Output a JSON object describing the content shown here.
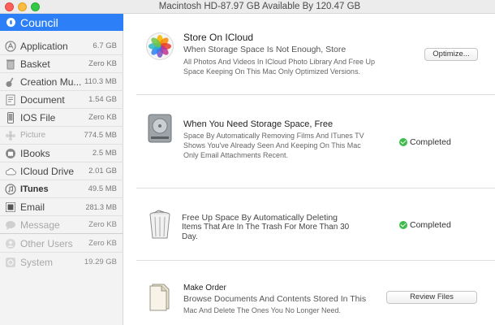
{
  "window": {
    "title": "Macintosh HD-87.97 GB Available By 120.47 GB"
  },
  "sidebar": {
    "selected": {
      "label": "Council"
    },
    "items": [
      {
        "label": "Application",
        "size": "6.7 GB",
        "icon": "application-icon"
      },
      {
        "label": "Basket",
        "size": "Zero KB",
        "icon": "trash-icon"
      },
      {
        "label": "Creation Mu...",
        "size": "110.3 MB",
        "icon": "guitar-icon"
      },
      {
        "label": "Document",
        "size": "1.54 GB",
        "icon": "document-icon"
      },
      {
        "label": "IOS File",
        "size": "Zero KB",
        "icon": "phone-icon"
      },
      {
        "label": "Picture",
        "size": "774.5 MB",
        "icon": "flower-icon"
      },
      {
        "label": "IBooks",
        "size": "2.5 MB",
        "icon": "book-icon"
      },
      {
        "label": "ICloud Drive",
        "size": "2.01 GB",
        "icon": "cloud-icon"
      },
      {
        "label": "ITunes",
        "size": "49.5 MB",
        "icon": "music-icon"
      },
      {
        "label": "Email",
        "size": "281.3 MB",
        "icon": "stamp-icon"
      },
      {
        "label": "Message",
        "size": "Zero KB",
        "icon": "message-icon"
      },
      {
        "label": "Other Users",
        "size": "Zero KB",
        "icon": "users-icon"
      },
      {
        "label": "System",
        "size": "19.29 GB",
        "icon": "gear-icon"
      }
    ]
  },
  "sections": {
    "icloud": {
      "title": "Store On ICloud",
      "line1": "When Storage Space Is Not Enough, Store",
      "desc": "All Photos And Videos In ICloud Photo Library And Free Up Space Keeping On This Mac Only Optimized Versions.",
      "button": "Optimize..."
    },
    "optimize": {
      "title": "When You Need Storage Space, Free",
      "desc": "Space By Automatically Removing Films And ITunes TV Shows You've Already Seen And Keeping On This Mac Only Email Attachments Recent.",
      "status": "Completed"
    },
    "trash": {
      "title": "Free Up Space By Automatically Deleting",
      "desc": "Items That Are In The Trash For More Than 30 Day.",
      "status": "Completed"
    },
    "clutter": {
      "title": "Make Order",
      "line1": "Browse Documents And Contents Stored In This",
      "desc": "Mac And Delete The Ones You No Longer Need.",
      "button": "Review Files"
    }
  },
  "colors": {
    "selection": "#2c7ff6",
    "check": "#3dbc4a"
  }
}
